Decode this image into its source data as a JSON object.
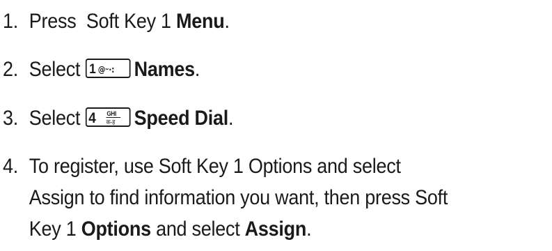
{
  "steps": [
    {
      "number": "1.",
      "pre": "Press  Soft Key 1 ",
      "bold": "Menu",
      "post": "."
    },
    {
      "number": "2.",
      "pre": "Select",
      "key": {
        "icon": "key-1-icon",
        "main": "1",
        "sub": "@ᵕ·:"
      },
      "bold": "Names",
      "post": "."
    },
    {
      "number": "3.",
      "pre": "Select",
      "key": {
        "icon": "key-4-icon",
        "main": "4",
        "sub_top": "GHI",
        "sub_bottom": "क-ह"
      },
      "bold": "Speed Dial",
      "post": "."
    },
    {
      "number": "4.",
      "line1": "To register, use Soft Key 1 Options and select",
      "line2": "Assign to find information you want, then press Soft",
      "line3_pre": "Key 1 ",
      "line3_bold1": "Options",
      "line3_mid": " and select ",
      "line3_bold2": "Assign",
      "line3_post": "."
    }
  ]
}
